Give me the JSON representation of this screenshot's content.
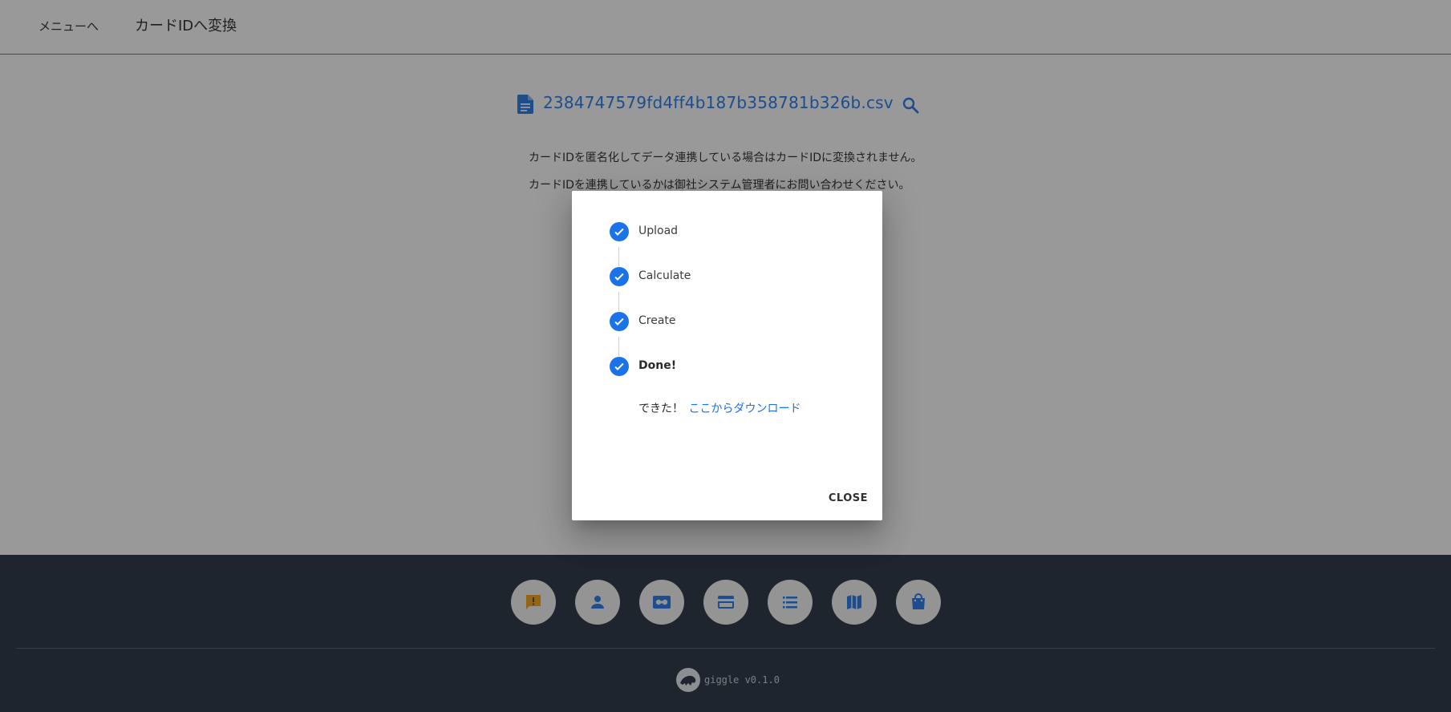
{
  "topbar": {
    "menu_link": "メニューへ",
    "convert_link": "カードIDへ変換"
  },
  "file": {
    "name": "2384747579fd4ff4b187b358781b326b.csv"
  },
  "notice": {
    "line1": "カードIDを匿名化してデータ連携している場合はカードIDに変換されません。",
    "line2": "カードIDを連携しているかは御社システム管理者にお問い合わせください。"
  },
  "dialog": {
    "steps": [
      {
        "label": "Upload",
        "status": "complete"
      },
      {
        "label": "Calculate",
        "status": "complete"
      },
      {
        "label": "Create",
        "status": "complete"
      },
      {
        "label": "Done!",
        "status": "complete"
      }
    ],
    "done_text": "できた！",
    "download_link": "ここからダウンロード",
    "close_label": "CLOSE"
  },
  "footer": {
    "buttons": [
      {
        "icon": "feedback-icon",
        "color": "#f2a10a"
      },
      {
        "icon": "person-icon",
        "color": "#1a73e8"
      },
      {
        "icon": "recording-icon",
        "color": "#1a73e8"
      },
      {
        "icon": "credit-card-icon",
        "color": "#1a73e8"
      },
      {
        "icon": "list-icon",
        "color": "#1a73e8"
      },
      {
        "icon": "map-icon",
        "color": "#1a73e8"
      },
      {
        "icon": "shopping-bag-icon",
        "color": "#1a73e8"
      }
    ],
    "brand": "giggle v0.1.0"
  },
  "colors": {
    "accent": "#1a73e8",
    "footer_bg": "#1e2a3a",
    "overlay": "rgba(33,33,33,0.46)"
  }
}
